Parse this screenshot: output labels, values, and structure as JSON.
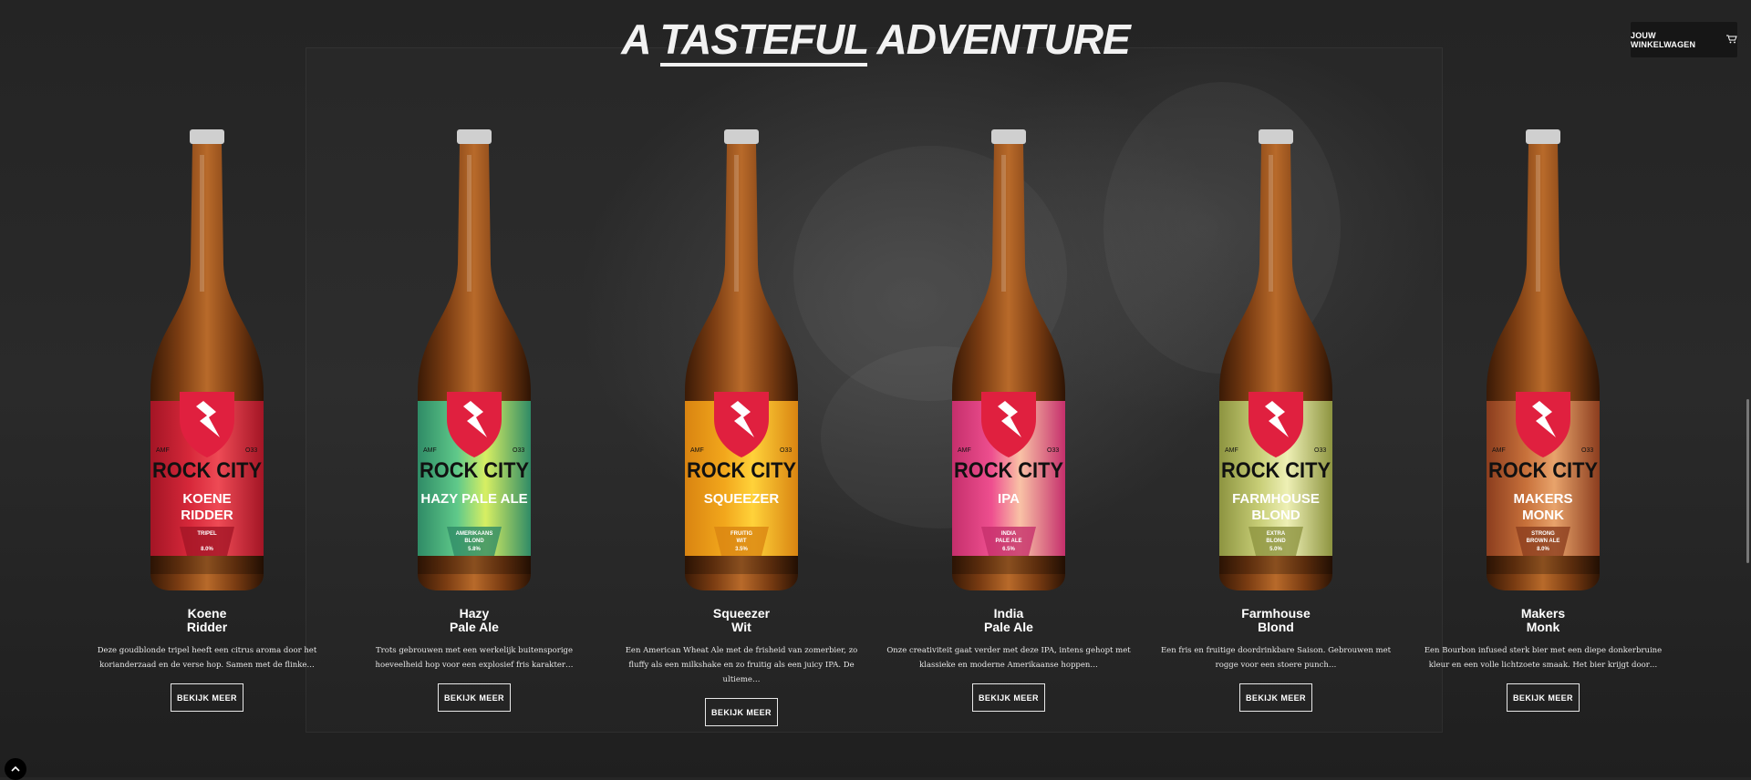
{
  "header": {
    "title_parts": [
      "A ",
      "Tasteful",
      " Adventure"
    ],
    "cart_label": "JOUW WINKELWAGEN",
    "cart_icon": "cart-icon"
  },
  "products": [
    {
      "name_line1": "Koene",
      "name_line2": "Ridder",
      "description": "Deze goudblonde tripel heeft een citrus aroma door het korianderzaad en de verse hop. Samen met de flinke…",
      "button": "BEKIJK MEER",
      "label": {
        "brand": "ROCK CITY",
        "amf": "AMF",
        "code": "O33",
        "line1": "KOENE",
        "line2": "RIDDER",
        "style1": "TRIPEL",
        "style2": "",
        "abv": "8.0%"
      },
      "colors": {
        "label": "#d7283a",
        "label_light": "#ee4a55",
        "band": "#a31525",
        "text": "#ffffff"
      }
    },
    {
      "name_line1": "Hazy",
      "name_line2": "Pale Ale",
      "description": "Trots gebrouwen met een werkelijk buitensporige hoeveelheid hop voor een explosief fris karakter…",
      "button": "BEKIJK MEER",
      "label": {
        "brand": "ROCK CITY",
        "amf": "AMF",
        "code": "O33",
        "line1": "HAZY PALE ALE",
        "line2": "",
        "style1": "AMERIKAANS",
        "style2": "BLOND",
        "abv": "5.8%"
      },
      "colors": {
        "label": "#5fc98a",
        "label_light": "#d7ef63",
        "band": "#2f8b66",
        "text": "#ffffff"
      }
    },
    {
      "name_line1": "Squeezer",
      "name_line2": "Wit",
      "description": "Een American Wheat Ale met de frisheid van zomerbier, zo fluffy als een milkshake en zo fruitig als een juicy IPA. De ultieme…",
      "button": "BEKIJK MEER",
      "label": {
        "brand": "ROCK CITY",
        "amf": "AMF",
        "code": "O33",
        "line1": "SQUEEZER",
        "line2": "",
        "style1": "FRUITIG",
        "style2": "WIT",
        "abv": "3.5%"
      },
      "colors": {
        "label": "#f2a71c",
        "label_light": "#ffd23a",
        "band": "#d98411",
        "text": "#ffffff"
      }
    },
    {
      "name_line1": "India",
      "name_line2": "Pale Ale",
      "description": "Onze creativiteit gaat verder met deze IPA, intens gehopt met klassieke en moderne Amerikaanse hoppen…",
      "button": "BEKIJK MEER",
      "label": {
        "brand": "ROCK CITY",
        "amf": "AMF",
        "code": "O33",
        "line1": "IPA",
        "line2": "",
        "style1": "INDIA",
        "style2": "PALE ALE",
        "abv": "6.5%"
      },
      "colors": {
        "label": "#ee4f8f",
        "label_light": "#f9c2a6",
        "band": "#c52f6c",
        "text": "#ffffff"
      }
    },
    {
      "name_line1": "Farmhouse",
      "name_line2": "Blond",
      "description": "Een fris en fruitige doordrinkbare Saison. Gebrouwen met rogge voor een stoere punch…",
      "button": "BEKIJK MEER",
      "label": {
        "brand": "ROCK CITY",
        "amf": "AMF",
        "code": "O33",
        "line1": "FARMHOUSE",
        "line2": "BLOND",
        "style1": "EXTRA",
        "style2": "BLOND",
        "abv": "5.0%"
      },
      "colors": {
        "label": "#c7cd76",
        "label_light": "#eef0b5",
        "band": "#8d9440",
        "text": "#ffffff"
      }
    },
    {
      "name_line1": "Makers",
      "name_line2": "Monk",
      "description": "Een Bourbon infused sterk bier met een diepe donkerbruine kleur en een volle lichtzoete smaak. Het bier krijgt door…",
      "button": "BEKIJK MEER",
      "label": {
        "brand": "ROCK CITY",
        "amf": "AMF",
        "code": "O33",
        "line1": "MAKERS",
        "line2": "MONK",
        "style1": "STRONG",
        "style2": "BROWN ALE",
        "abv": "8.0%"
      },
      "colors": {
        "label": "#c8713b",
        "label_light": "#e8a36b",
        "band": "#8b3d1e",
        "text": "#ffffff"
      }
    }
  ],
  "ui": {
    "back_to_top_icon": "chevron-up-icon",
    "beer_color": "#7a3c12",
    "beer_color_light": "#b86a2a",
    "shield_color": "#e0203f"
  }
}
